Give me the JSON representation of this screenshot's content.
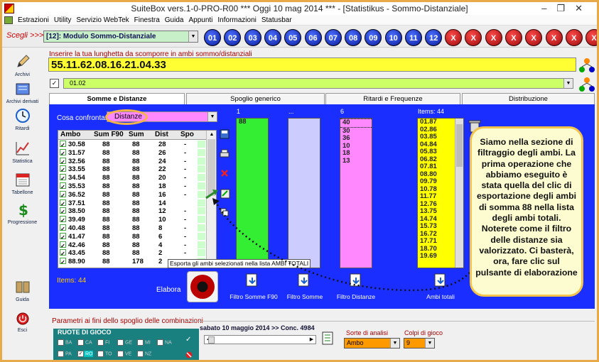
{
  "window": {
    "title": "SuiteBox vers.1-0-PRO-R00  ***  Oggi 10 mag 2014  ***   - [Statistikus - Sommo-Distanziale]",
    "min": "–",
    "max": "❐",
    "close": "✕"
  },
  "menu": [
    "Estrazioni",
    "Utility",
    "Servizio WebTek",
    "Finestra",
    "Guida",
    "Appunti",
    "Informazioni",
    "Statusbar"
  ],
  "toolbar": {
    "scegli_label": "Scegli >>>",
    "module_value": "[12]: Modulo Sommo-Distanziale",
    "num_buttons": [
      "01",
      "02",
      "03",
      "04",
      "05",
      "06",
      "07",
      "08",
      "09",
      "10",
      "11",
      "12"
    ],
    "x_buttons": [
      "X",
      "X",
      "X",
      "X",
      "X",
      "X",
      "X",
      "X"
    ]
  },
  "sidebar": {
    "items": [
      {
        "label": "Archivi",
        "icon": "pencil-icon"
      },
      {
        "label": "Archivi derivati",
        "icon": "archive-icon"
      },
      {
        "label": "Ritardi",
        "icon": "clock-icon"
      },
      {
        "label": "Statistica",
        "icon": "chart-icon"
      },
      {
        "label": "Tabellone",
        "icon": "calendar-icon"
      },
      {
        "label": "Progressione",
        "icon": "dollar-icon"
      },
      {
        "label": "Guida",
        "icon": "book-icon"
      },
      {
        "label": "Esci",
        "icon": "exit-icon"
      }
    ]
  },
  "main": {
    "prompt_label": "Inserire la tua lunghetta da scomporre in ambi sommo/distanziali",
    "lunghetta_value": "55.11.62.08.16.21.04.33",
    "secondary_value": "01.02",
    "secondary_checkbox": "✓"
  },
  "tabs": [
    {
      "label": "Somme e Distanze",
      "active": true
    },
    {
      "label": "Spoglio generico",
      "active": false
    },
    {
      "label": "Ritardi e Frequenze",
      "active": false
    },
    {
      "label": "Distribuzione",
      "active": false
    }
  ],
  "filter": {
    "cosa_label": "Cosa confrontare",
    "selected": "Distanze"
  },
  "table": {
    "headers": [
      "Ambo",
      "Sum F90",
      "Sum",
      "Dist",
      "Spo"
    ],
    "rows": [
      {
        "ambo": "30.58",
        "sumf90": "88",
        "sum": "88",
        "dist": "28",
        "spo": "-"
      },
      {
        "ambo": "31.57",
        "sumf90": "88",
        "sum": "88",
        "dist": "26",
        "spo": "-"
      },
      {
        "ambo": "32.56",
        "sumf90": "88",
        "sum": "88",
        "dist": "24",
        "spo": "-"
      },
      {
        "ambo": "33.55",
        "sumf90": "88",
        "sum": "88",
        "dist": "22",
        "spo": "-"
      },
      {
        "ambo": "34.54",
        "sumf90": "88",
        "sum": "88",
        "dist": "20",
        "spo": "-"
      },
      {
        "ambo": "35.53",
        "sumf90": "88",
        "sum": "88",
        "dist": "18",
        "spo": "-"
      },
      {
        "ambo": "36.52",
        "sumf90": "88",
        "sum": "88",
        "dist": "16",
        "spo": "-"
      },
      {
        "ambo": "37.51",
        "sumf90": "88",
        "sum": "88",
        "dist": "14",
        "spo": ""
      },
      {
        "ambo": "38.50",
        "sumf90": "88",
        "sum": "88",
        "dist": "12",
        "spo": "-"
      },
      {
        "ambo": "39.49",
        "sumf90": "88",
        "sum": "88",
        "dist": "10",
        "spo": "-"
      },
      {
        "ambo": "40.48",
        "sumf90": "88",
        "sum": "88",
        "dist": "8",
        "spo": "-"
      },
      {
        "ambo": "41.47",
        "sumf90": "88",
        "sum": "88",
        "dist": "6",
        "spo": "-"
      },
      {
        "ambo": "42.46",
        "sumf90": "88",
        "sum": "88",
        "dist": "4",
        "spo": "-"
      },
      {
        "ambo": "43.45",
        "sumf90": "88",
        "sum": "88",
        "dist": "2",
        "spo": "-"
      },
      {
        "ambo": "88.90",
        "sumf90": "88",
        "sum": "178",
        "dist": "2",
        "spo": "-"
      }
    ],
    "checkmark": "✓",
    "items_label": "Items: 44"
  },
  "tooltip": "Esporta gli ambi selezionati nella lista AMBI TOTALI",
  "columns": {
    "somme_head": "1",
    "somme_items": [
      "88"
    ],
    "col2_head": "...",
    "distanze_head": "6",
    "distanze_items": [
      "40",
      "30",
      "36",
      "10",
      "18",
      "13"
    ],
    "ambi_head": "Items: 44",
    "ambi_items": [
      "01.87",
      "02.86",
      "03.85",
      "04.84",
      "05.83",
      "06.82",
      "07.81",
      "08.80",
      "09.79",
      "10.78",
      "11.77",
      "12.76",
      "13.75",
      "14.74",
      "15.73",
      "16.72",
      "17.71",
      "18.70",
      "19.69"
    ]
  },
  "funnel_labels": {
    "f1": "Filtro Somme F90",
    "f2": "Filtro Somme",
    "f3": "Filtro Distanze",
    "f4": "Ambi totali"
  },
  "elabora_label": "Elabora",
  "callout_text": "Siamo nella sezione di filtraggio degli ambi. La prima operazione che abbiamo eseguito è stata quella del clic di esportazione degli ambi di somma 88 nella lista degli ambi totali. Noterete come il filtro delle distanze sia valorizzato. Ci basterà, ora, fare clic sul pulsante di elaborazione",
  "bottom": {
    "params_label": "Parametri ai fini dello spoglio delle combinazioni",
    "ruote_label": "RUOTE DI GIOCO",
    "ruote": [
      {
        "name": "BA",
        "checked": false
      },
      {
        "name": "CA",
        "checked": false
      },
      {
        "name": "FI",
        "checked": false
      },
      {
        "name": "GE",
        "checked": false
      },
      {
        "name": "MI",
        "checked": false
      },
      {
        "name": "NA",
        "checked": false
      },
      {
        "name": "PA",
        "checked": false
      },
      {
        "name": "RO",
        "checked": true
      },
      {
        "name": "TO",
        "checked": false
      },
      {
        "name": "VE",
        "checked": false
      },
      {
        "name": "NZ",
        "checked": false
      }
    ],
    "date_label": "sabato 10 maggio 2014 >> Conc. 4984",
    "sorte_label": "Sorte di analisi",
    "sorte_value": "Ambo",
    "colpi_label": "Colpi di gioco",
    "colpi_value": "9"
  },
  "colors": {
    "accent_blue": "#1a2eff",
    "yellow": "#ffff33",
    "green": "#ccff66",
    "pink": "#ff88ff",
    "orange": "#ff9900"
  }
}
